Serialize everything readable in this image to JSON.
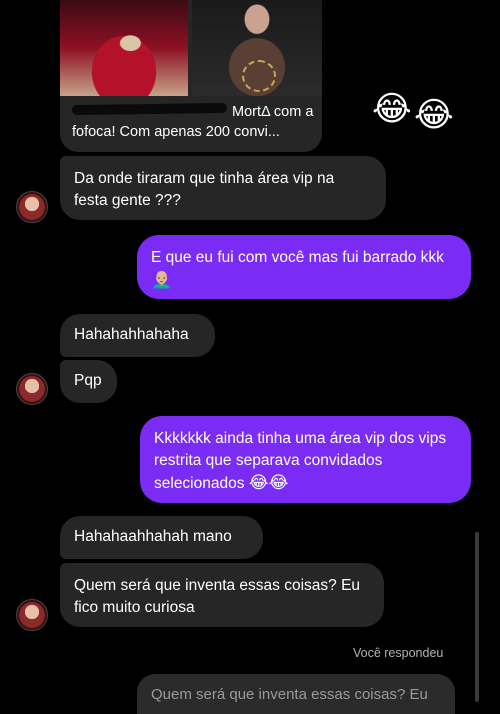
{
  "shared_post": {
    "caption_line1": "MortΔ com a",
    "caption_line2": "fofoca! Com apenas 200 convi..."
  },
  "reaction": {
    "emoji1": "😂",
    "emoji2": "😂"
  },
  "messages": [
    {
      "side": "in",
      "text": "Da onde tiraram que tinha área vip na festa gente ???"
    },
    {
      "side": "out",
      "text": "E que eu fui com você mas fui barrado kkk",
      "emoji": "👨🏼‍🦲"
    },
    {
      "side": "in",
      "text": "Hahahahhahaha"
    },
    {
      "side": "in",
      "text": "Pqp"
    },
    {
      "side": "out",
      "text": "Kkkkkkk ainda tinha uma área vip dos vips restrita que separava convidados selecionados",
      "emoji": "😂😂"
    },
    {
      "side": "in",
      "text": "Hahahaahhahah mano"
    },
    {
      "side": "in",
      "text": "Quem será que inventa essas coisas? Eu fico muito curiosa"
    }
  ],
  "reply": {
    "label": "Você respondeu",
    "quoted": "Quem será que inventa essas coisas? Eu"
  }
}
